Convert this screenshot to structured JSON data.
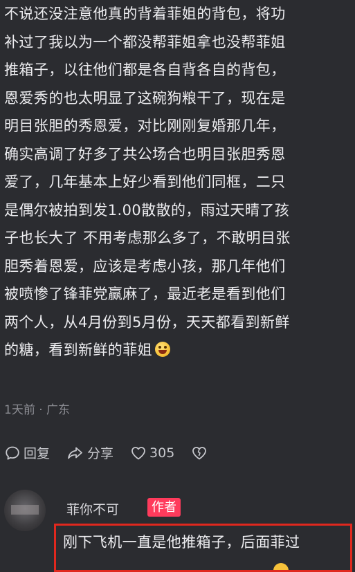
{
  "comment": {
    "lines": [
      "不说还没注意他真的背着菲姐的背包，将功",
      "补过了我以为一个都没帮菲姐拿也没帮菲姐",
      "推箱子，以往他们都是各自背各自的背包，",
      "恩爱秀的也太明显了这碗狗粮干了，现在是",
      "明目张胆的秀恩爱，对比刚刚复婚那几年，",
      "确实高调了好多了共公场合也明目张胆秀恩",
      "爱了，几年基本上好少看到他们同框，二只",
      "是偶尔被拍到发1.00散散的，雨过天晴了孩",
      "子也长大了 不用考虑那么多了，不敢明目张",
      "胆秀着恩爱，应该是考虑小孩，那几年他们",
      "被喷惨了锋菲党赢麻了，最近老是看到他们",
      "两个人，从4月份到5月份，天天都看到新鲜",
      "的糖，看到新鲜的菲姐"
    ],
    "emoji_icon": "laughing-face-emoji",
    "meta": "1天前 · 广东",
    "actions": {
      "reply_label": "回复",
      "share_label": "分享",
      "like_count": "305"
    }
  },
  "reply": {
    "username": "菲你不可",
    "badge": "作者",
    "text": "刚下飞机一直是他推箱子，后面菲过"
  },
  "colors": {
    "background": "#2b2c30",
    "text": "#ececef",
    "meta": "#8d8e94",
    "author_badge": "#ff3b5c",
    "highlight_border": "#e0281e"
  }
}
